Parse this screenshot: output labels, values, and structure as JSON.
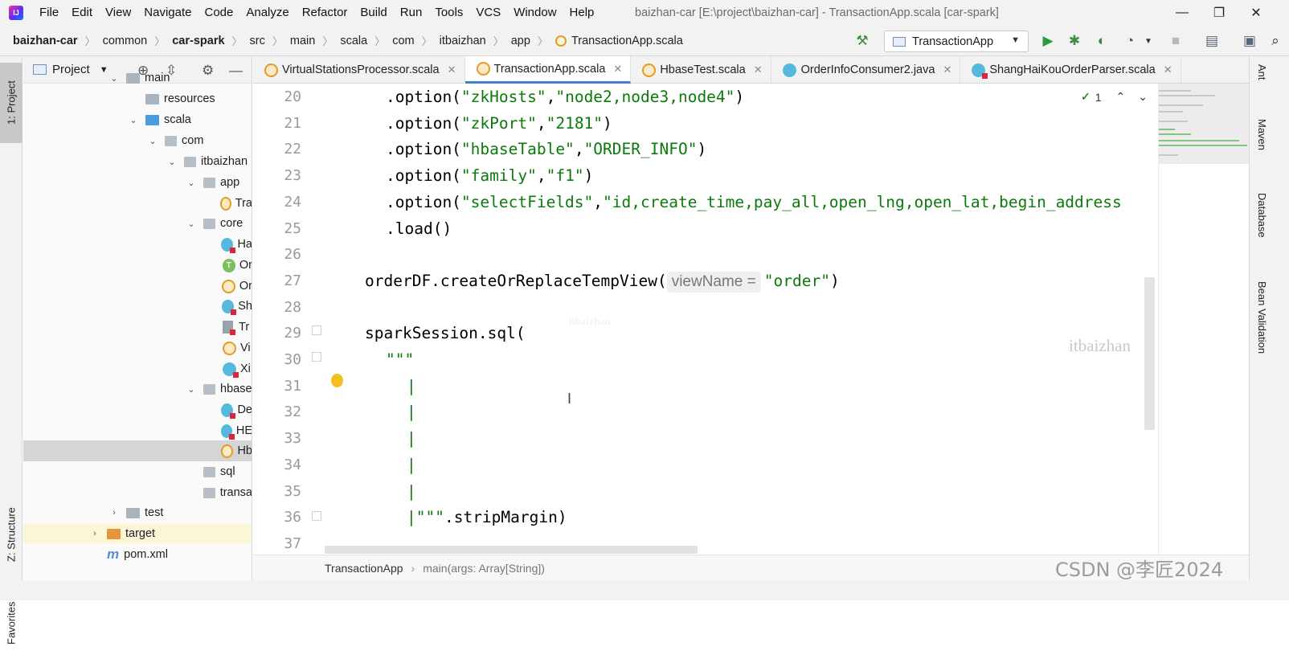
{
  "menubar": {
    "logo": "IJ",
    "items": [
      "File",
      "Edit",
      "View",
      "Navigate",
      "Code",
      "Analyze",
      "Refactor",
      "Build",
      "Run",
      "Tools",
      "VCS",
      "Window",
      "Help"
    ],
    "window_title": "baizhan-car [E:\\project\\baizhan-car] - TransactionApp.scala [car-spark]",
    "controls": [
      "—",
      "❐",
      "✕"
    ]
  },
  "navbar": {
    "crumbs": [
      "baizhan-car",
      "common",
      "car-spark",
      "src",
      "main",
      "scala",
      "com",
      "itbaizhan",
      "app",
      "TransactionApp.scala"
    ],
    "run_config": "TransactionApp"
  },
  "left_strip": {
    "project_tab": "1: Project",
    "structure_tab": "Z: Structure",
    "favorites_tab": "Favorites"
  },
  "project_panel": {
    "title": "Project",
    "tree": [
      {
        "label": "main",
        "kind": "folder",
        "indent": 0,
        "expanded": true
      },
      {
        "label": "resources",
        "kind": "res",
        "indent": 1
      },
      {
        "label": "scala",
        "kind": "folder-blue",
        "indent": 1,
        "expanded": true
      },
      {
        "label": "com",
        "kind": "pkg",
        "indent": 2,
        "expanded": true
      },
      {
        "label": "itbaizhan",
        "kind": "pkg",
        "indent": 3,
        "expanded": true
      },
      {
        "label": "app",
        "kind": "pkg",
        "indent": 4,
        "expanded": true
      },
      {
        "label": "Tra",
        "kind": "scala",
        "indent": 5
      },
      {
        "label": "core",
        "kind": "pkg",
        "indent": 4,
        "expanded": true
      },
      {
        "label": "Ha",
        "kind": "class",
        "indent": 5
      },
      {
        "label": "Or",
        "kind": "trait",
        "indent": 5
      },
      {
        "label": "Or",
        "kind": "scala",
        "indent": 5
      },
      {
        "label": "Sh",
        "kind": "class",
        "indent": 5
      },
      {
        "label": "Tr",
        "kind": "file",
        "indent": 5
      },
      {
        "label": "Vi",
        "kind": "scala",
        "indent": 5
      },
      {
        "label": "Xi",
        "kind": "class",
        "indent": 5
      },
      {
        "label": "hbase",
        "kind": "pkg",
        "indent": 4,
        "expanded": true
      },
      {
        "label": "De",
        "kind": "class",
        "indent": 5
      },
      {
        "label": "HE",
        "kind": "class",
        "indent": 5
      },
      {
        "label": "Hb",
        "kind": "scala",
        "indent": 5,
        "selected": true
      },
      {
        "label": "sql",
        "kind": "pkg",
        "indent": 4
      },
      {
        "label": "transa",
        "kind": "pkg",
        "indent": 4
      },
      {
        "label": "test",
        "kind": "folder",
        "indent": 0,
        "collapsed": true
      },
      {
        "label": "target",
        "kind": "folder-orange",
        "indent": -1,
        "collapsed": true,
        "target": true
      },
      {
        "label": "pom.xml",
        "kind": "maven",
        "indent": -1
      }
    ]
  },
  "editor_tabs": [
    {
      "label": "VirtualStationsProcessor.scala",
      "icon": "scala"
    },
    {
      "label": "TransactionApp.scala",
      "icon": "scala",
      "active": true
    },
    {
      "label": "HbaseTest.scala",
      "icon": "scala"
    },
    {
      "label": "OrderInfoConsumer2.java",
      "icon": "java"
    },
    {
      "label": "ShangHaiKouOrderParser.scala",
      "icon": "class"
    }
  ],
  "code": {
    "lines": [
      {
        "n": "20",
        "indent": 54,
        "parts": [
          [
            "",
            ".option("
          ],
          [
            "str",
            "\"zkHosts\""
          ],
          [
            "",
            ","
          ],
          [
            "str",
            "\"node2,node3,node4\""
          ],
          [
            "",
            ")"
          ]
        ]
      },
      {
        "n": "21",
        "indent": 54,
        "parts": [
          [
            "",
            ".option("
          ],
          [
            "str",
            "\"zkPort\""
          ],
          [
            "",
            ","
          ],
          [
            "str",
            "\"2181\""
          ],
          [
            "",
            ")"
          ]
        ]
      },
      {
        "n": "22",
        "indent": 54,
        "parts": [
          [
            "",
            ".option("
          ],
          [
            "str",
            "\"hbaseTable\""
          ],
          [
            "",
            ","
          ],
          [
            "str",
            "\"ORDER_INFO\""
          ],
          [
            "",
            ")"
          ]
        ]
      },
      {
        "n": "23",
        "indent": 54,
        "parts": [
          [
            "",
            ".option("
          ],
          [
            "str",
            "\"family\""
          ],
          [
            "",
            ","
          ],
          [
            "str",
            "\"f1\""
          ],
          [
            "",
            ")"
          ]
        ]
      },
      {
        "n": "24",
        "indent": 54,
        "parts": [
          [
            "",
            ".option("
          ],
          [
            "str",
            "\"selectFields\""
          ],
          [
            "",
            ","
          ],
          [
            "str",
            "\"id,create_time,pay_all,open_lng,open_lat,begin_address"
          ]
        ]
      },
      {
        "n": "25",
        "indent": 54,
        "parts": [
          [
            "",
            ".load()"
          ]
        ]
      },
      {
        "n": "26",
        "indent": 0,
        "parts": []
      },
      {
        "n": "27",
        "indent": 28,
        "parts": [
          [
            "",
            "orderDF.createOrReplaceTempView("
          ],
          [
            "hint",
            "viewName ="
          ],
          [
            "str",
            "\"order\""
          ],
          [
            "",
            ")"
          ]
        ]
      },
      {
        "n": "28",
        "indent": 0,
        "parts": []
      },
      {
        "n": "29",
        "indent": 28,
        "parts": [
          [
            "",
            "sparkSession.sql("
          ]
        ]
      },
      {
        "n": "30",
        "indent": 54,
        "parts": [
          [
            "str",
            "\"\"\""
          ]
        ]
      },
      {
        "n": "31",
        "indent": 80,
        "parts": [
          [
            "str",
            "|"
          ]
        ]
      },
      {
        "n": "32",
        "indent": 80,
        "parts": [
          [
            "str",
            "|"
          ]
        ]
      },
      {
        "n": "33",
        "indent": 80,
        "parts": [
          [
            "str",
            "|"
          ]
        ]
      },
      {
        "n": "34",
        "indent": 80,
        "parts": [
          [
            "str",
            "|"
          ]
        ]
      },
      {
        "n": "35",
        "indent": 80,
        "parts": [
          [
            "str",
            "|"
          ]
        ]
      },
      {
        "n": "36",
        "indent": 80,
        "parts": [
          [
            "str",
            "|\"\"\""
          ],
          [
            "",
            ".stripMargin)"
          ]
        ]
      },
      {
        "n": "37",
        "indent": 0,
        "parts": []
      }
    ],
    "inspection_count": "1",
    "watermark": "itbaizhan",
    "watermark_faint": "itbaizhan"
  },
  "right_strip": [
    "Ant",
    "Maven",
    "Database",
    "Bean Validation"
  ],
  "code_crumbs": {
    "class_name": "TransactionApp",
    "method": "main(args: Array[String])"
  },
  "csdn_mark": "CSDN @李匠2024",
  "colors": {
    "accent": "#4083c9",
    "string": "#0b7a0b",
    "current_line": "#fcfae6"
  }
}
